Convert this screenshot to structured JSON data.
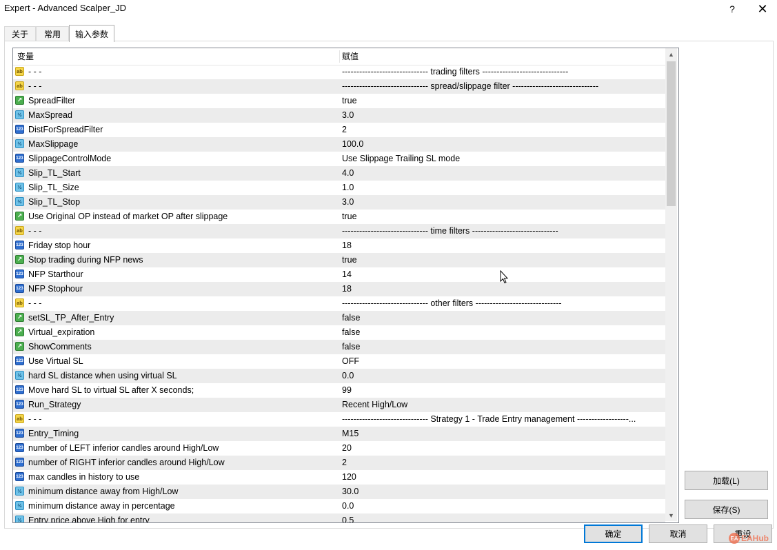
{
  "window": {
    "title": "Expert - Advanced Scalper_JD",
    "help_label": "?",
    "close_label": "✕"
  },
  "tabs": [
    {
      "label": "关于"
    },
    {
      "label": "常用"
    },
    {
      "label": "输入参数"
    }
  ],
  "grid": {
    "header_variable": "变量",
    "header_value": "赋值",
    "rows": [
      {
        "type": "ab",
        "name": "- - -",
        "value": "------------------------------ trading filters ------------------------------"
      },
      {
        "type": "ab",
        "name": "- - -",
        "value": "------------------------------ spread/slippage filter ------------------------------"
      },
      {
        "type": "bool",
        "name": "SpreadFilter",
        "value": "true"
      },
      {
        "type": "dbl",
        "name": "MaxSpread",
        "value": "3.0"
      },
      {
        "type": "int",
        "name": "DistForSpreadFilter",
        "value": "2"
      },
      {
        "type": "dbl",
        "name": "MaxSlippage",
        "value": "100.0"
      },
      {
        "type": "int",
        "name": "SlippageControlMode",
        "value": "Use Slippage Trailing SL mode"
      },
      {
        "type": "dbl",
        "name": "Slip_TL_Start",
        "value": "4.0"
      },
      {
        "type": "dbl",
        "name": "Slip_TL_Size",
        "value": "1.0"
      },
      {
        "type": "dbl",
        "name": "Slip_TL_Stop",
        "value": "3.0"
      },
      {
        "type": "bool",
        "name": "Use Original OP instead of market OP after slippage",
        "value": "true"
      },
      {
        "type": "ab",
        "name": "- - -",
        "value": "------------------------------ time filters ------------------------------"
      },
      {
        "type": "int",
        "name": "Friday stop hour",
        "value": "18"
      },
      {
        "type": "bool",
        "name": "Stop trading during NFP news",
        "value": "true"
      },
      {
        "type": "int",
        "name": "NFP Starthour",
        "value": "14"
      },
      {
        "type": "int",
        "name": "NFP Stophour",
        "value": "18"
      },
      {
        "type": "ab",
        "name": "- - -",
        "value": "------------------------------ other filters ------------------------------"
      },
      {
        "type": "bool",
        "name": "setSL_TP_After_Entry",
        "value": "false"
      },
      {
        "type": "bool",
        "name": "Virtual_expiration",
        "value": "false"
      },
      {
        "type": "bool",
        "name": "ShowComments",
        "value": "false"
      },
      {
        "type": "int",
        "name": "Use Virtual SL",
        "value": "OFF"
      },
      {
        "type": "dbl",
        "name": "hard SL distance when using virtual SL",
        "value": "0.0"
      },
      {
        "type": "int",
        "name": "Move hard SL to virtual SL after X seconds;",
        "value": "99"
      },
      {
        "type": "int",
        "name": "Run_Strategy",
        "value": "Recent High/Low"
      },
      {
        "type": "ab",
        "name": "- - -",
        "value": "------------------------------ Strategy 1 - Trade Entry management ------------------..."
      },
      {
        "type": "int",
        "name": "Entry_Timing",
        "value": "M15"
      },
      {
        "type": "int",
        "name": "number of LEFT inferior candles around High/Low",
        "value": "20"
      },
      {
        "type": "int",
        "name": "number of RIGHT inferior candles around High/Low",
        "value": "2"
      },
      {
        "type": "int",
        "name": "max candles in history to use",
        "value": "120"
      },
      {
        "type": "dbl",
        "name": "minimum distance away from High/Low",
        "value": "30.0"
      },
      {
        "type": "dbl",
        "name": "minimum distance away in percentage",
        "value": "0.0"
      },
      {
        "type": "dbl",
        "name": "Entry price above High for entry",
        "value": "0.5"
      }
    ]
  },
  "icons": {
    "ab": "string-param-icon",
    "bool": "bool-param-icon",
    "dbl": "double-param-icon",
    "int": "int-param-icon"
  },
  "buttons": {
    "load": "加载(L)",
    "save": "保存(S)",
    "ok": "确定",
    "cancel": "取消",
    "reset": "重设"
  },
  "watermark": "EAHub"
}
